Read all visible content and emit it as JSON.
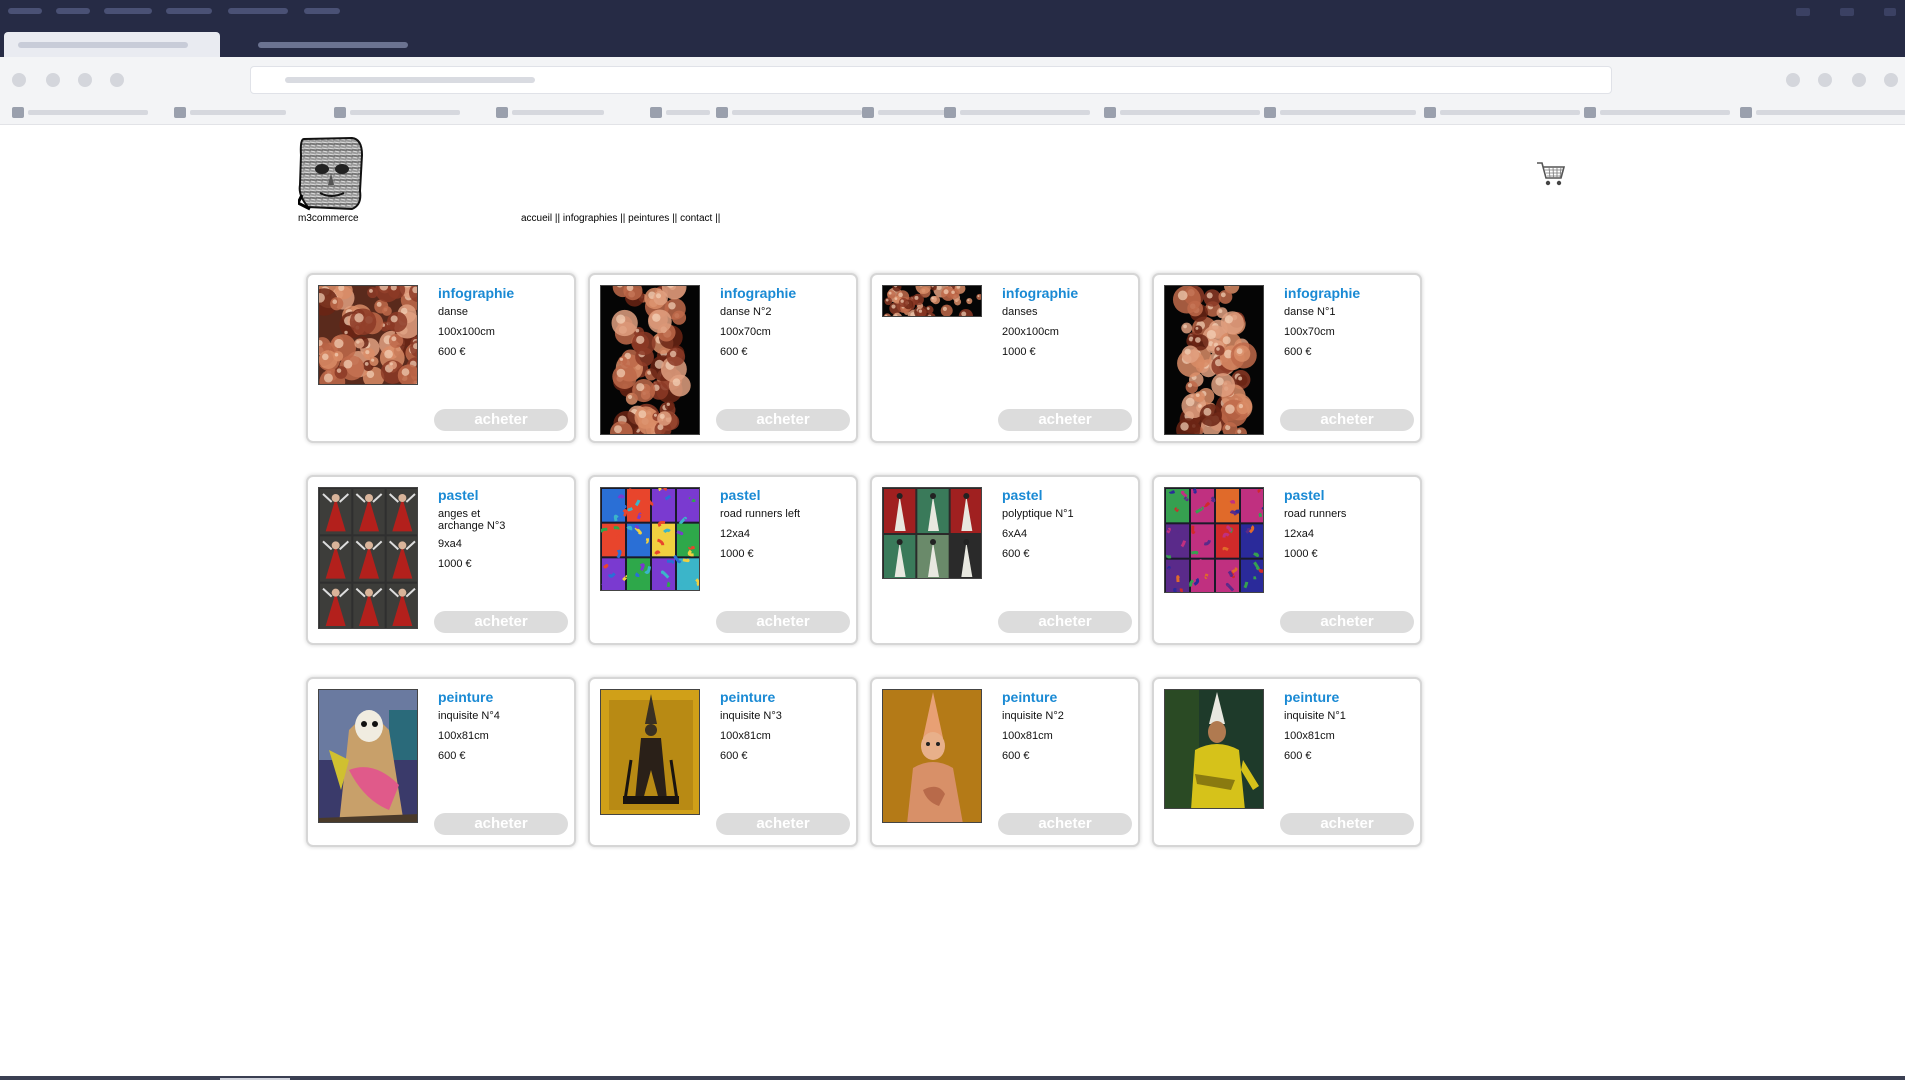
{
  "site": {
    "caption": "m3commerce"
  },
  "nav": {
    "items": [
      "accueil",
      "infographies",
      "peintures",
      "contact"
    ],
    "separator": " || "
  },
  "buy_label": "acheter",
  "products": [
    {
      "category": "infographie",
      "title": "danse",
      "size": "100x100cm",
      "price": "600 €",
      "art": "danse-sq"
    },
    {
      "category": "infographie",
      "title": "danse N°2",
      "size": "100x70cm",
      "price": "600 €",
      "art": "danse-tall"
    },
    {
      "category": "infographie",
      "title": "danses",
      "size": "200x100cm",
      "price": "1000 €",
      "art": "danses-wide"
    },
    {
      "category": "infographie",
      "title": "danse N°1",
      "size": "100x70cm",
      "price": "600 €",
      "art": "danse-tall"
    },
    {
      "category": "pastel",
      "title": "anges et archange N°3",
      "size": "9xa4",
      "price": "1000 €",
      "art": "anges"
    },
    {
      "category": "pastel",
      "title": "road runners left",
      "size": "12xa4",
      "price": "1000 €",
      "art": "roadleft"
    },
    {
      "category": "pastel",
      "title": "polyptique N°1",
      "size": "6xA4",
      "price": "600 €",
      "art": "polyptique"
    },
    {
      "category": "pastel",
      "title": "road runners",
      "size": "12xa4",
      "price": "1000 €",
      "art": "roadrunners"
    },
    {
      "category": "peinture",
      "title": "inquisite N°4",
      "size": "100x81cm",
      "price": "600 €",
      "art": "inq4"
    },
    {
      "category": "peinture",
      "title": "inquisite N°3",
      "size": "100x81cm",
      "price": "600 €",
      "art": "inq3"
    },
    {
      "category": "peinture",
      "title": "inquisite N°2",
      "size": "100x81cm",
      "price": "600 €",
      "art": "inq2"
    },
    {
      "category": "peinture",
      "title": "inquisite N°1",
      "size": "100x81cm",
      "price": "600 €",
      "art": "inq1"
    }
  ]
}
